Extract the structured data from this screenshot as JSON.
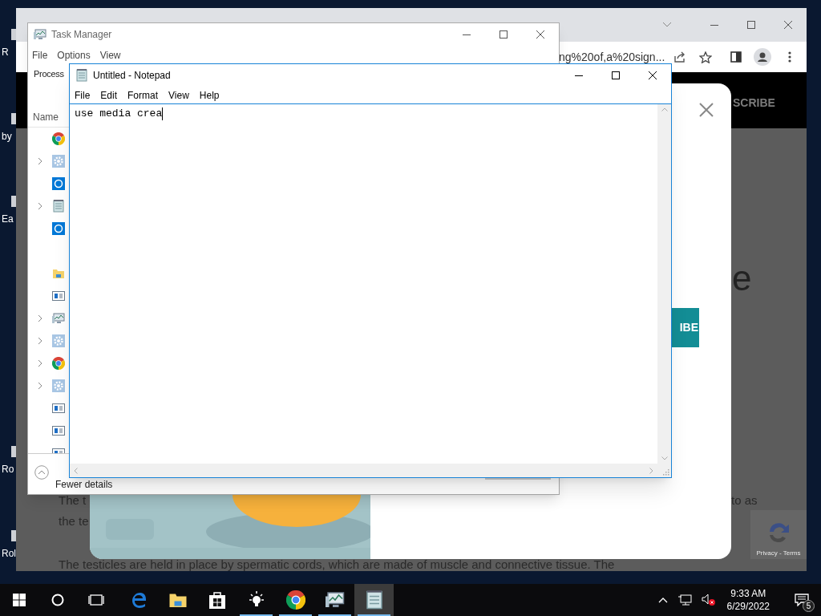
{
  "desktop": {
    "icon_labels": [
      "R",
      "by",
      "Ea",
      "Ro",
      "Rol"
    ]
  },
  "browser": {
    "address": "ng%20of,a%20sign...",
    "header_text": "SCRIBE",
    "heading_fragment": "e",
    "page_texts": [
      "The t",
      "to as",
      "the te",
      "The testicles are held in place by spermatic cords, which are made of muscle and connective tissue. The"
    ],
    "modal": {
      "button": "IBE"
    },
    "recaptcha": "Privacy - Terms"
  },
  "task_manager": {
    "title": "Task Manager",
    "menu": [
      "File",
      "Options",
      "View"
    ],
    "tab": "Process",
    "column": "Name",
    "row_groups": [
      [
        {
          "expandable": false
        },
        {
          "expandable": true
        },
        {
          "expandable": false
        },
        {
          "expandable": true
        },
        {
          "expandable": false
        }
      ],
      [
        {
          "expandable": false
        },
        {
          "expandable": false
        },
        {
          "expandable": true
        },
        {
          "expandable": true
        },
        {
          "expandable": true
        },
        {
          "expandable": true
        },
        {
          "expandable": false
        },
        {
          "expandable": false
        },
        {
          "expandable": false
        }
      ]
    ],
    "footer": "Fewer details"
  },
  "notepad": {
    "title": "Untitled - Notepad",
    "menu": [
      "File",
      "Edit",
      "Format",
      "View",
      "Help"
    ],
    "text": "use media crea"
  },
  "taskbar": {
    "apps": [
      {
        "running": false,
        "selected": false
      },
      {
        "running": false,
        "selected": false
      },
      {
        "running": false,
        "selected": false
      },
      {
        "running": true,
        "selected": false
      },
      {
        "running": true,
        "selected": false
      },
      {
        "running": true,
        "selected": false
      },
      {
        "running": true,
        "selected": true
      }
    ],
    "time": "9:33 AM",
    "date": "6/29/2022",
    "notification_count": "5"
  }
}
